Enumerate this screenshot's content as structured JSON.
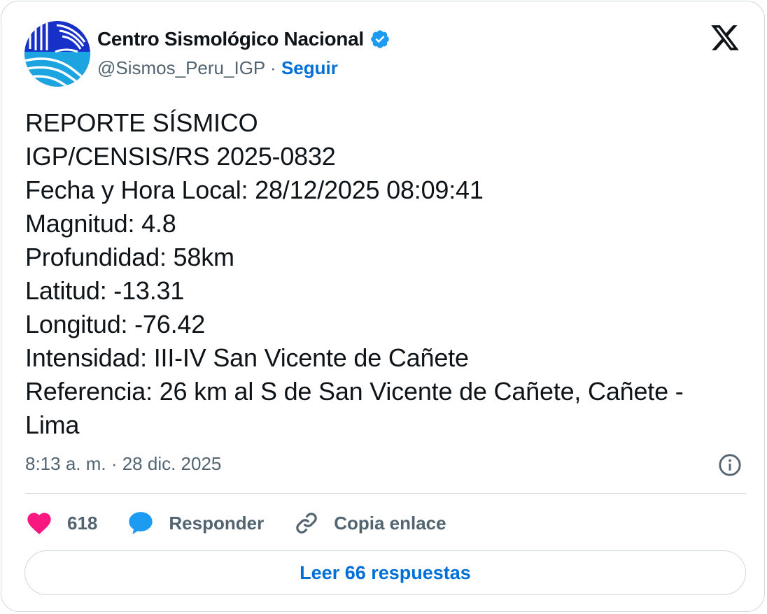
{
  "author": {
    "name": "Centro Sismológico Nacional",
    "handle": "@Sismos_Peru_IGP",
    "separator": "·",
    "follow_label": "Seguir",
    "verified": true
  },
  "tweet": {
    "lines": [
      "REPORTE SÍSMICO",
      "IGP/CENSIS/RS 2025-0832",
      "Fecha y Hora Local: 28/12/2025 08:09:41",
      "Magnitud: 4.8",
      "Profundidad: 58km",
      "Latitud: -13.31",
      "Longitud: -76.42",
      "Intensidad: III-IV San Vicente de Cañete",
      "Referencia: 26 km al S de San Vicente de Cañete, Cañete -",
      "Lima"
    ],
    "timestamp": "8:13 a. m. · 28 dic. 2025"
  },
  "actions": {
    "like_count": "618",
    "reply_label": "Responder",
    "copy_link_label": "Copia enlace"
  },
  "replies_button_label": "Leer 66 respuestas",
  "icons": {
    "platform": "x-logo-icon",
    "verified": "verified-badge-icon",
    "info": "info-icon",
    "like": "heart-icon",
    "reply": "speech-bubble-icon",
    "copy_link": "link-icon"
  },
  "colors": {
    "accent": "#006fd6",
    "verified": "#1d9bf0",
    "like": "#f91880",
    "muted_text": "#536471",
    "border": "#cfd9de"
  }
}
